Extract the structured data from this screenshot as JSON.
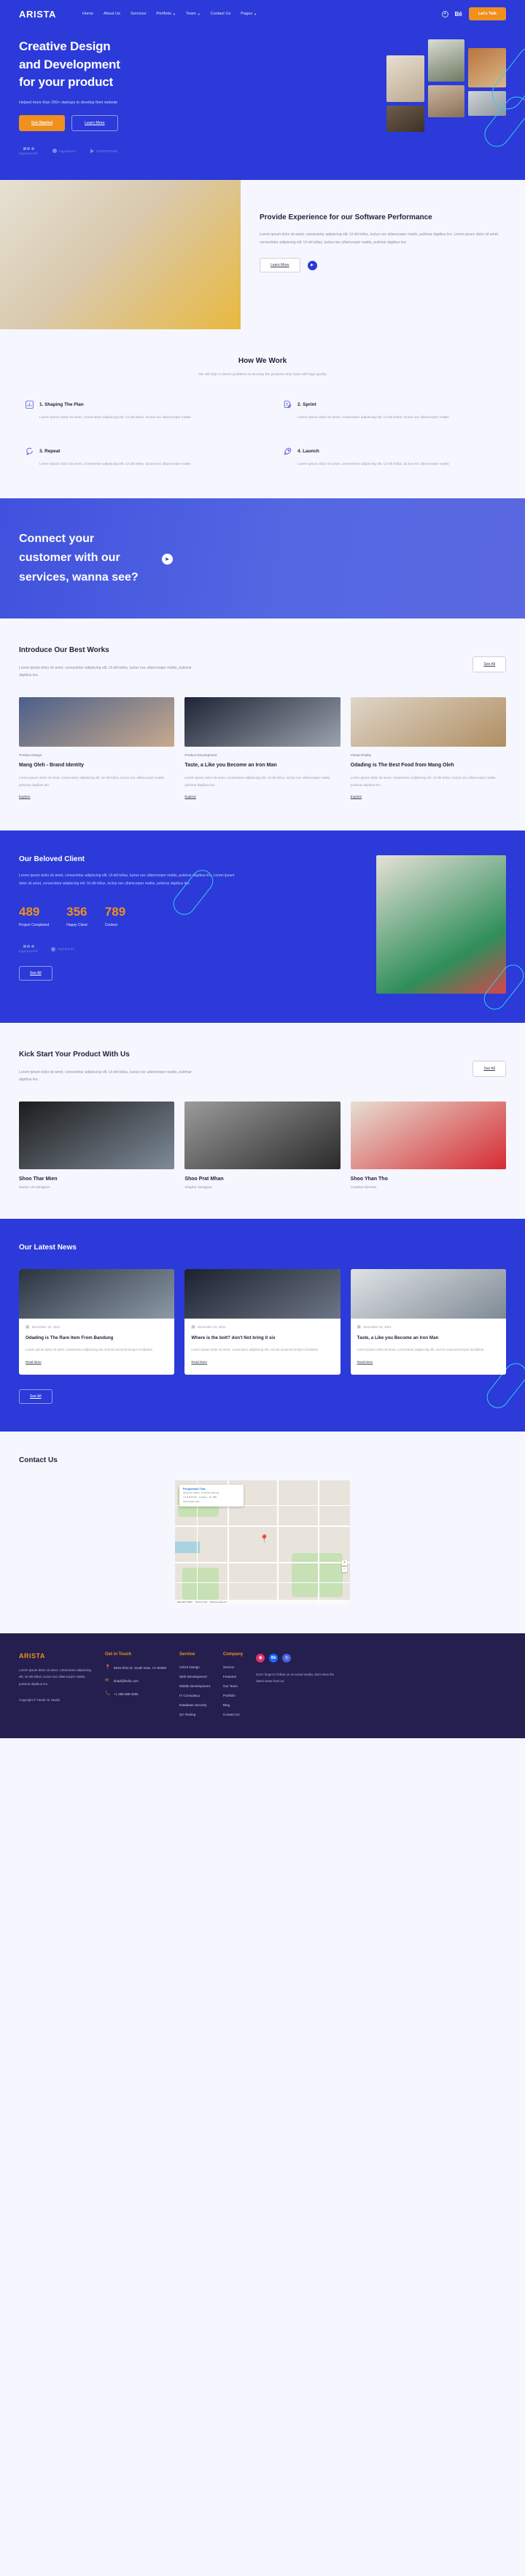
{
  "brand": {
    "name": "ARISTA"
  },
  "nav": {
    "links": [
      {
        "label": "Home",
        "caret": false
      },
      {
        "label": "About Us",
        "caret": false
      },
      {
        "label": "Services",
        "caret": false
      },
      {
        "label": "Portfolio",
        "caret": true
      },
      {
        "label": "Team",
        "caret": true
      },
      {
        "label": "Contact Us",
        "caret": false
      },
      {
        "label": "Pages",
        "caret": true
      }
    ],
    "dribbble_icon": "dribbble-icon",
    "behance_label": "Bē",
    "cta": "Let's Talk"
  },
  "hero": {
    "title_lines": [
      "Creative Design",
      "and Development",
      "for your product"
    ],
    "subtitle": "Helped more than 200+ startups to develop their website",
    "btn_primary": "Get Started",
    "btn_secondary": "Learn More",
    "logos": [
      {
        "name": "logoipsum®",
        "type": "dots"
      },
      {
        "name": "logoipsum",
        "type": "stack"
      },
      {
        "name": "LOGOIPSUM",
        "type": "arrow"
      }
    ]
  },
  "experience": {
    "title": "Provide Experience for our Software Performance",
    "body": "Lorem ipsum dolor sit amet, consectetur adipiscing elit. Ut elit tellus, luctus nec ullamcorper mattis, pulvinar dapibus leo. Lorem ipsum dolor sit amet, consectetur adipiscing elit. Ut elit tellus, luctus nec ullamcorper mattis, pulvinar dapibus leo.",
    "button": "Learn More",
    "play_icon": "play-icon"
  },
  "how_we_work": {
    "title": "How We Work",
    "subtitle": "We will help a client's problems to develop the products they have with high quality",
    "steps": [
      {
        "icon": "chart-icon",
        "name": "1. Shaping The Plan",
        "desc": "Lorem ipsum dolor sit amet, consectetur adipiscing elit. Ut elit tellus, luctus nec ullamcorper mattis"
      },
      {
        "icon": "document-edit-icon",
        "name": "2. Sprint",
        "desc": "Lorem ipsum dolor sit amet, consectetur adipiscing elit. Ut elit tellus, luctus nec ullamcorper mattis"
      },
      {
        "icon": "refresh-icon",
        "name": "3. Repeat",
        "desc": "Lorem ipsum dolor sit amet, consectetur adipiscing elit. Ut elit tellus, luctus nec ullamcorper mattis"
      },
      {
        "icon": "rocket-icon",
        "name": "4. Launch",
        "desc": "Lorem ipsum dolor sit amet, consectetur adipiscing elit. Ut elit tellus, luctus nec ullamcorper mattis"
      }
    ]
  },
  "connect": {
    "title_lines": [
      "Connect your",
      "customer with our",
      "services, wanna see?"
    ],
    "play_icon": "play-icon"
  },
  "works": {
    "title": "Introduce Our Best Works",
    "desc": "Lorem ipsum dolor sit amet, consectetur adipiscing elit. Ut elit tellus, luctus nec ullamcorper mattis, pulvinar dapibus leo.",
    "see_all": "See All",
    "items": [
      {
        "cat": "Product Design",
        "title": "Mang Oleh - Brand Identity",
        "desc": "Lorem ipsum dolor sit amet, consectetur adipiscing elit. Ut elit tellus, luctus nec ullamcorper mattis, pulvinar dapibus leo.",
        "link": "Explore"
      },
      {
        "cat": "Product Development",
        "title": "Taste, a Like you Become an Iron Man",
        "desc": "Lorem ipsum dolor sit amet, consectetur adipiscing elit. Ut elit tellus, luctus nec ullamcorper mattis, pulvinar dapibus leo.",
        "link": "Explore"
      },
      {
        "cat": "Virtual Reality",
        "title": "Odading is The Best Food from Mang Oleh",
        "desc": "Lorem ipsum dolor sit amet, consectetur adipiscing elit. Ut elit tellus, luctus nec ullamcorper mattis, pulvinar dapibus leo.",
        "link": "Explore"
      }
    ]
  },
  "client": {
    "title": "Our Beloved Client",
    "desc": "Lorem ipsum dolor sit amet, consectetur adipiscing elit. Ut elit tellus, luctus nec ullamcorper mattis, pulvinar dapibus leo. Lorem ipsum dolor sit amet, consectetur adipiscing elit. Ut elit tellus, luctus nec ullamcorper mattis, pulvinar dapibus leo.",
    "stats": [
      {
        "number": "489",
        "label": "Project Completed"
      },
      {
        "number": "356",
        "label": "Happy Client"
      },
      {
        "number": "789",
        "label": "Contest"
      }
    ],
    "see_all": "See All"
  },
  "team": {
    "title": "Kick Start Your Product With Us",
    "desc": "Lorem ipsum dolor sit amet, consectetur adipiscing elit. Ut elit tellus, luctus nec ullamcorper mattis, pulvinar dapibus leo.",
    "see_all": "See All",
    "members": [
      {
        "name": "Shoo Thar Mien",
        "role": "Senior UX Designer"
      },
      {
        "name": "Shoo Prat Mhan",
        "role": "Graphic Designer"
      },
      {
        "name": "Shoo Yhan Tho",
        "role": "Creative Director"
      }
    ]
  },
  "news": {
    "title": "Our Latest News",
    "see_all": "See All",
    "items": [
      {
        "date": "December 18, 2021",
        "title": "Odading is The Rare Item From Bandung",
        "desc": "Lorem ipsum dolor sit amet, consectetur adipiscing elit, sed do eiusmod tempor incididunt",
        "link": "Read More"
      },
      {
        "date": "December 18, 2021",
        "title": "Where is the bolt? don't Not bring it six",
        "desc": "Lorem ipsum dolor sit amet, consectetur adipiscing elit, sed do eiusmod tempor incididunt",
        "link": "Read More"
      },
      {
        "date": "December 18, 2021",
        "title": "Taste, a Like you Become an Iron Man",
        "desc": "Lorem ipsum dolor sit amet, consectetur adipiscing elit, sed do eiusmod tempor incididunt",
        "link": "Read More"
      }
    ]
  },
  "contact": {
    "title": "Contact Us",
    "map": {
      "card_title": "Pengkursahl Thac",
      "card_sub_1": "Tanah Air Studio, Jl. Kebon Kawung",
      "card_sub_2": "4.9 ★★★★★ · Creative · St. 289",
      "card_link": "View larger map",
      "zoom_in": "+",
      "zoom_out": "−",
      "footer_items": [
        "Map data ©2021",
        "Terms of Use",
        "Report a map error"
      ]
    }
  },
  "footer": {
    "logo": "ARISTA",
    "about": "Lorem ipsum dolor sit amet, consectetur adipiscing elit. Ut elit tellus, luctus nec ullamcorper mattis, pulvinar dapibus leo.",
    "copyright": "Copyright © Tanah Air Studio",
    "get_in_touch": {
      "heading": "Get in Touch",
      "address": "8819 Ohio St. South Gate, CA 90280",
      "email": "khadi@hello.com",
      "phone": "+1 386-688-3295"
    },
    "service": {
      "heading": "Service",
      "items": [
        "UI/UX Design",
        "Web Development",
        "Mobile Development",
        "IT Consultacy",
        "Database Security",
        "QA Testing"
      ]
    },
    "company": {
      "heading": "Company",
      "items": [
        "Service",
        "Features",
        "Our Team",
        "Portfolio",
        "Blog",
        "Contact Us"
      ]
    },
    "social": {
      "note": "Don't forget to follow us on social media, don't miss the latest news from us.",
      "items": [
        {
          "name": "instagram-icon",
          "glyph": "◉",
          "color": "#e1306c"
        },
        {
          "name": "behance-icon",
          "glyph": "Bē",
          "color": "#1769ff"
        },
        {
          "name": "dribbble-icon",
          "glyph": "◎",
          "color": "#4b5fe0"
        }
      ]
    }
  },
  "colors": {
    "brand_blue": "#2b3ad8",
    "accent_orange": "#f0901e",
    "footer_navy": "#241f4e",
    "bg_light": "#f6f6fe"
  }
}
